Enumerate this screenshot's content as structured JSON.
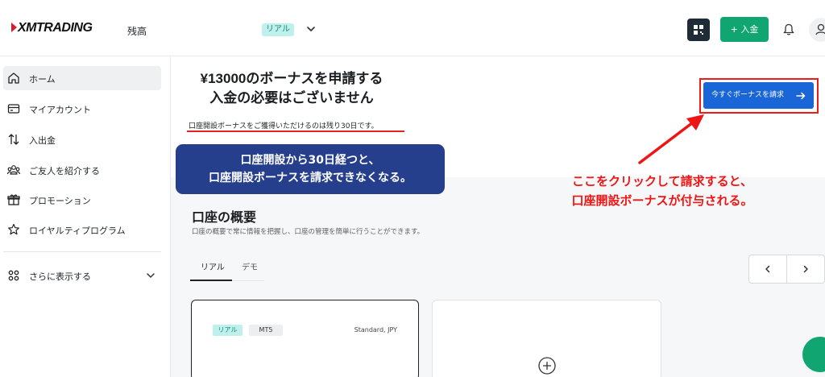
{
  "header": {
    "logo": "XMTRADING",
    "balance_label": "残高",
    "account_badge": "リアル",
    "deposit_label": "+ 入金"
  },
  "sidebar": {
    "items": [
      {
        "label": "ホーム",
        "icon": "home-icon"
      },
      {
        "label": "マイアカウント",
        "icon": "card-icon"
      },
      {
        "label": "入出金",
        "icon": "transfer-icon"
      },
      {
        "label": "ご友人を紹介する",
        "icon": "people-icon"
      },
      {
        "label": "プロモーション",
        "icon": "gift-icon"
      },
      {
        "label": "ロイヤルティプログラム",
        "icon": "star-icon"
      }
    ],
    "more_label": "さらに表示する"
  },
  "promo": {
    "title_line1": "¥13000のボーナスを申請する",
    "title_line2": "入金の必要はございません",
    "subtitle": "口座開設ボーナスをご獲得いただけるのは残り30日です。",
    "claim_button": "今すぐボーナスを請求"
  },
  "annotations": {
    "bubble_line1": "口座開設から30日経つと、",
    "bubble_line2": "口座開設ボーナスを請求できなくなる。",
    "red_line1": "ここをクリックして請求すると、",
    "red_line2": "口座開設ボーナスが付与される。"
  },
  "overview": {
    "title": "口座の概要",
    "description": "口座の概要で常に情報を把握し、口座の管理を簡単に行うことができます。",
    "tabs": [
      "リアル",
      "デモ"
    ],
    "active_tab": "リアル",
    "card": {
      "badge": "リアル",
      "platform": "MT5",
      "type": "Standard, JPY"
    }
  },
  "colors": {
    "accent_green": "#10a571",
    "button_blue": "#1a66d6",
    "annotation_red": "#f01515",
    "bubble_navy": "#263f8d"
  }
}
